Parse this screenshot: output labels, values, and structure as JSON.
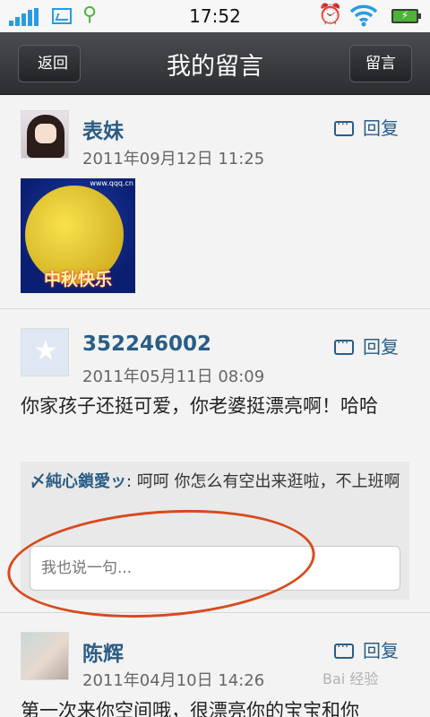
{
  "status_bar": {
    "time": "17:52",
    "icons": [
      "signal-icon",
      "image-icon",
      "usb-icon",
      "alarm-icon",
      "wifi-icon",
      "battery-charging-icon"
    ],
    "accent_color": "#2a9be0"
  },
  "navbar": {
    "back_label": "返回",
    "title": "我的留言",
    "action_label": "留言"
  },
  "posts": [
    {
      "author": "表妹",
      "date": "2011年09月12日 11:25",
      "reply_label": "回复",
      "image_caption": "中秋快乐",
      "image_watermark": "www.qqq.cn"
    },
    {
      "author": "352246002",
      "date": "2011年05月11日 08:09",
      "reply_label": "回复",
      "text": "你家孩子还挺可爱，你老婆挺漂亮啊！哈哈",
      "comment": {
        "author": "〆純心鎖愛ッ",
        "text": ": 呵呵  你怎么有空出来逛啦，不上班啊"
      },
      "input_placeholder": "我也说一句..."
    },
    {
      "author": "陈辉",
      "date": "2011年04月10日 14:26",
      "reply_label": "回复",
      "text": "第一次来你空间哦，很漂亮你的宝宝和你"
    }
  ],
  "watermark": "Bai 经验",
  "link_color": "#2a5d86",
  "annotation_color": "#d84a1e"
}
